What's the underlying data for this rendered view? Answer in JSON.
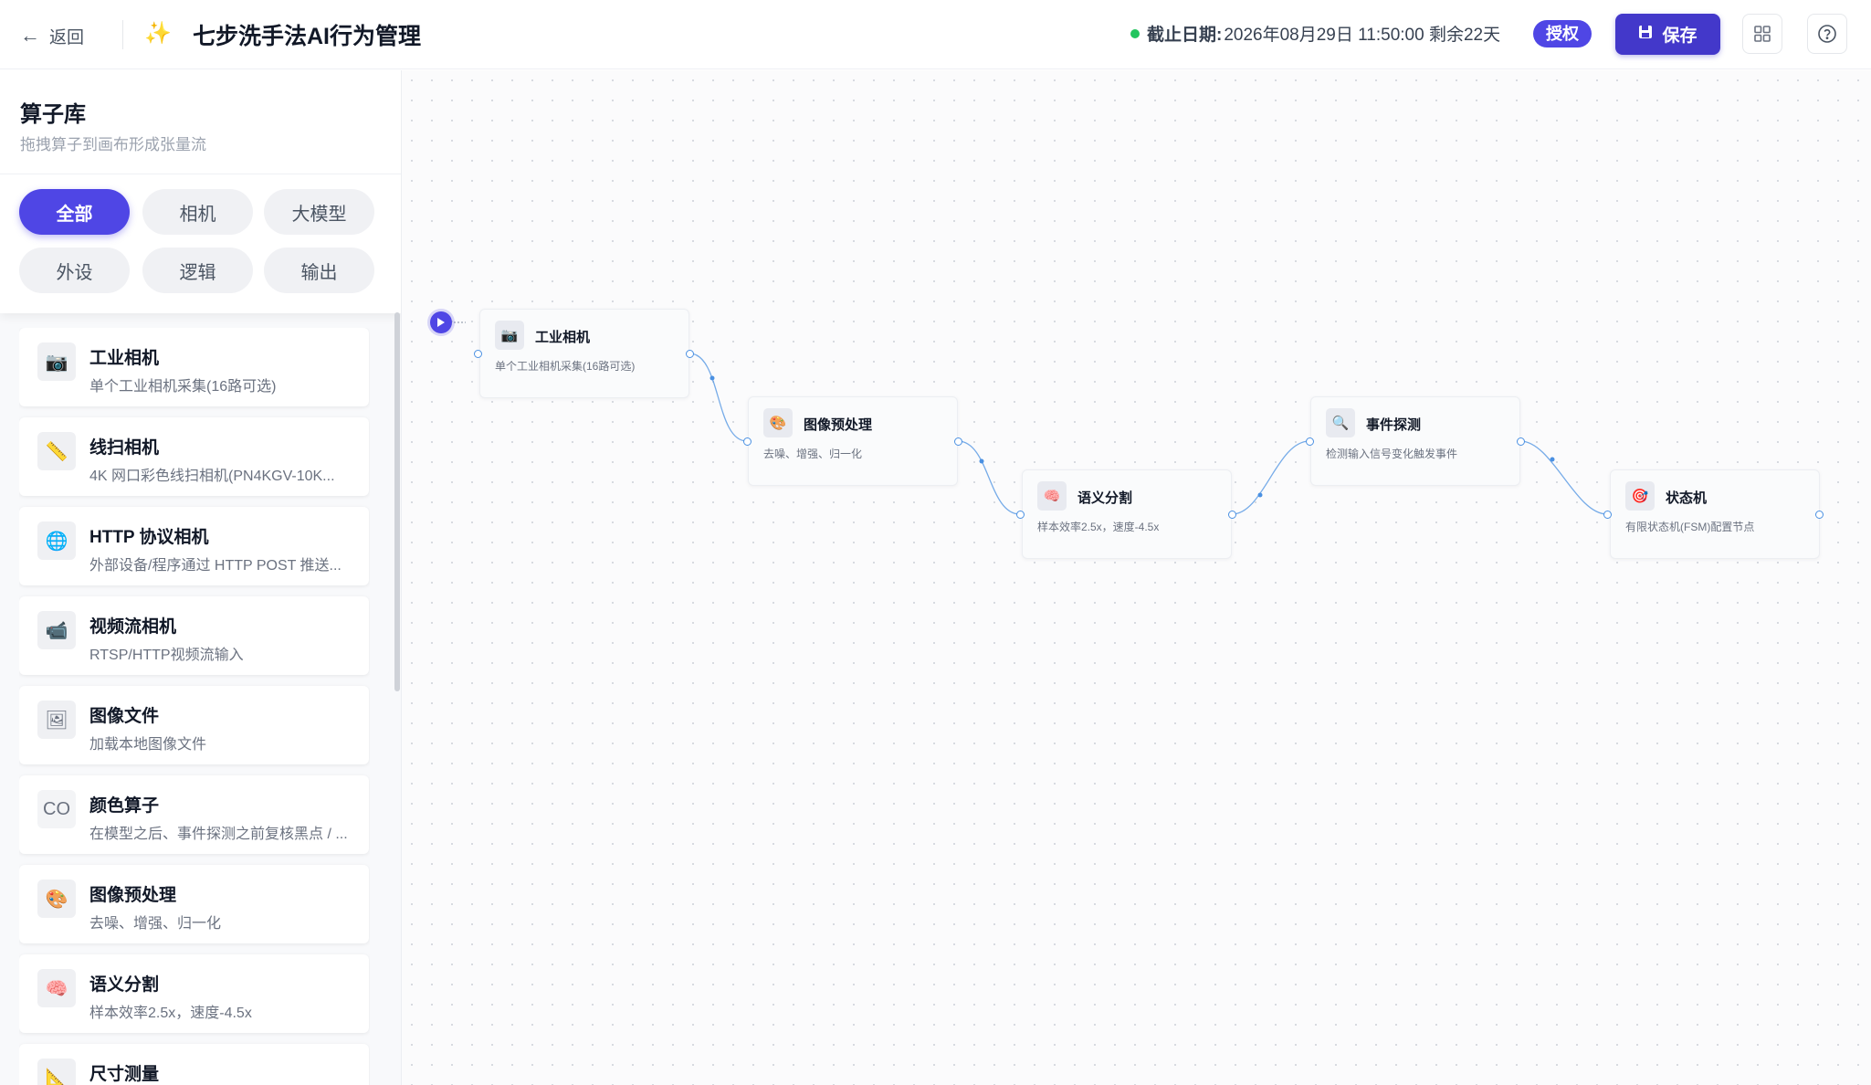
{
  "header": {
    "back_label": "返回",
    "title": "七步洗手法AI行为管理",
    "deadline_label": "截止日期:",
    "deadline_value": "2026年08月29日 11:50:00 剩余22天",
    "auth_badge": "授权",
    "save_label": "保存"
  },
  "sidebar": {
    "title": "算子库",
    "subtitle": "拖拽算子到画布形成张量流",
    "filters": [
      "全部",
      "相机",
      "大模型",
      "外设",
      "逻辑",
      "输出"
    ],
    "active_filter": "全部",
    "operators": [
      {
        "icon": "📷",
        "name": "工业相机",
        "desc": "单个工业相机采集(16路可选)"
      },
      {
        "icon": "📏",
        "name": "线扫相机",
        "desc": "4K 网口彩色线扫相机(PN4KGV-10K..."
      },
      {
        "icon": "🌐",
        "name": "HTTP 协议相机",
        "desc": "外部设备/程序通过 HTTP POST 推送..."
      },
      {
        "icon": "📹",
        "name": "视频流相机",
        "desc": "RTSP/HTTP视频流输入"
      },
      {
        "icon": "🖼",
        "name": "图像文件",
        "desc": "加载本地图像文件"
      },
      {
        "icon": "CO",
        "name": "颜色算子",
        "desc": "在模型之后、事件探测之前复核黑点 / ..."
      },
      {
        "icon": "🎨",
        "name": "图像预处理",
        "desc": "去噪、增强、归一化"
      },
      {
        "icon": "🧠",
        "name": "语义分割",
        "desc": "样本效率2.5x，速度-4.5x"
      },
      {
        "icon": "📐",
        "name": "尺寸测量",
        "desc": ""
      }
    ]
  },
  "canvas": {
    "nodes": [
      {
        "icon": "📷",
        "title": "工业相机",
        "desc": "单个工业相机采集(16路可选)"
      },
      {
        "icon": "🎨",
        "title": "图像预处理",
        "desc": "去噪、增强、归一化"
      },
      {
        "icon": "🧠",
        "title": "语义分割",
        "desc": "样本效率2.5x，速度-4.5x"
      },
      {
        "icon": "🔍",
        "title": "事件探测",
        "desc": "检测输入信号变化触发事件"
      },
      {
        "icon": "🎯",
        "title": "状态机",
        "desc": "有限状态机(FSM)配置节点"
      }
    ]
  },
  "colors": {
    "accent": "#4f46e5",
    "save_button": "#4338ca",
    "status_dot": "#22c55e",
    "edge": "#4a90e2"
  }
}
